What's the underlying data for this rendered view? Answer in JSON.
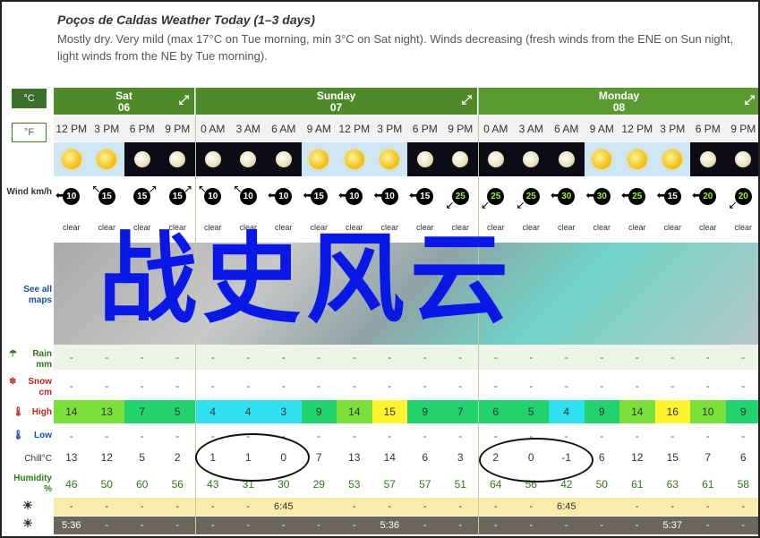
{
  "header": {
    "title": "Poços de Caldas Weather Today (1–3 days)",
    "description": "Mostly dry. Very mild (max 17°C on Tue morning, min 3°C on Sat night). Winds decreasing (fresh winds from the ENE on Sun night, light winds from the NE by Tue morning)."
  },
  "units": {
    "celsius": "°C",
    "fahrenheit": "°F"
  },
  "side_labels": {
    "wind": "Wind km/h",
    "maps": "See all maps",
    "rain": "Rain mm",
    "snow": "Snow cm",
    "high": "High",
    "low": "Low",
    "chill": "Chill°C",
    "humidity": "Humidity %"
  },
  "days": [
    {
      "name": "Sat",
      "date": "06",
      "span": 4
    },
    {
      "name": "Sunday",
      "date": "07",
      "span": 8
    },
    {
      "name": "Monday",
      "date": "08",
      "span": 8
    }
  ],
  "times": [
    "12 PM",
    "3 PM",
    "6 PM",
    "9 PM",
    "0 AM",
    "3 AM",
    "6 AM",
    "9 AM",
    "12 PM",
    "3 PM",
    "6 PM",
    "9 PM",
    "0 AM",
    "3 AM",
    "6 AM",
    "9 AM",
    "12 PM",
    "3 PM",
    "6 PM",
    "9 PM"
  ],
  "icons": [
    "sun",
    "sun",
    "moon",
    "moon",
    "moon",
    "moon",
    "moon",
    "sun",
    "sun",
    "sun",
    "moon",
    "moon",
    "moon",
    "moon",
    "moon",
    "sun",
    "sun",
    "sun",
    "moon",
    "moon"
  ],
  "wind": {
    "speeds": [
      "10",
      "15",
      "15",
      "15",
      "10",
      "10",
      "10",
      "15",
      "10",
      "10",
      "15",
      "25",
      "25",
      "25",
      "30",
      "30",
      "25",
      "15",
      "20",
      "20"
    ],
    "green": [
      false,
      false,
      false,
      false,
      false,
      false,
      false,
      false,
      false,
      false,
      false,
      true,
      true,
      true,
      true,
      true,
      true,
      false,
      true,
      true
    ],
    "directions": [
      "left",
      "up-left",
      "up-right",
      "up-right",
      "up-left",
      "up-left",
      "left",
      "left",
      "left",
      "left",
      "left",
      "down-left",
      "down-left",
      "down-left",
      "left",
      "left",
      "left",
      "left",
      "left",
      "down-left"
    ]
  },
  "conditions": [
    "clear",
    "clear",
    "clear",
    "clear",
    "clear",
    "clear",
    "clear",
    "clear",
    "clear",
    "clear",
    "clear",
    "clear",
    "clear",
    "clear",
    "clear",
    "clear",
    "clear",
    "clear",
    "clear",
    "clear"
  ],
  "rain": [
    "-",
    "-",
    "-",
    "-",
    "-",
    "-",
    "-",
    "-",
    "-",
    "-",
    "-",
    "-",
    "-",
    "-",
    "-",
    "-",
    "-",
    "-",
    "-",
    "-"
  ],
  "snow": [
    "-",
    "-",
    "-",
    "-",
    "-",
    "-",
    "-",
    "-",
    "-",
    "-",
    "-",
    "-",
    "-",
    "-",
    "-",
    "-",
    "-",
    "-",
    "-",
    "-"
  ],
  "high": [
    "14",
    "13",
    "7",
    "5",
    "4",
    "4",
    "3",
    "9",
    "14",
    "15",
    "9",
    "7",
    "6",
    "5",
    "4",
    "9",
    "14",
    "16",
    "10",
    "9"
  ],
  "high_colors": [
    "#7ae03a",
    "#7ae03a",
    "#22d36d",
    "#22d36d",
    "#2fe0f0",
    "#2fe0f0",
    "#2fe0f0",
    "#22d36d",
    "#7ae03a",
    "#fff22e",
    "#22d36d",
    "#22d36d",
    "#22d36d",
    "#22d36d",
    "#2fe0f0",
    "#22d36d",
    "#7ae03a",
    "#fff22e",
    "#7ae03a",
    "#22d36d"
  ],
  "low": [
    "-",
    "-",
    "-",
    "-",
    "-",
    "-",
    "-",
    "-",
    "-",
    "-",
    "-",
    "-",
    "-",
    "-",
    "-",
    "-",
    "-",
    "-",
    "-",
    "-"
  ],
  "chill": [
    "13",
    "12",
    "5",
    "2",
    "1",
    "1",
    "0",
    "7",
    "13",
    "14",
    "6",
    "3",
    "2",
    "0",
    "-1",
    "6",
    "12",
    "15",
    "7",
    "6"
  ],
  "humidity": [
    "46",
    "50",
    "60",
    "56",
    "43",
    "31",
    "30",
    "29",
    "53",
    "57",
    "57",
    "51",
    "64",
    "56",
    "42",
    "50",
    "61",
    "63",
    "61",
    "58"
  ],
  "sunrise": [
    "-",
    "-",
    "-",
    "-",
    "-",
    "-",
    "6:45",
    "",
    "-",
    "-",
    "-",
    "-",
    "-",
    "-",
    "6:45",
    "",
    "-",
    "-",
    "-",
    "-"
  ],
  "sunset": [
    "5:36",
    "-",
    "-",
    "-",
    "-",
    "-",
    "-",
    "-",
    "-",
    "5:36",
    "-",
    "-",
    "-",
    "-",
    "-",
    "-",
    "-",
    "5:37",
    "-",
    "-"
  ],
  "overlay_text": "战史风云"
}
